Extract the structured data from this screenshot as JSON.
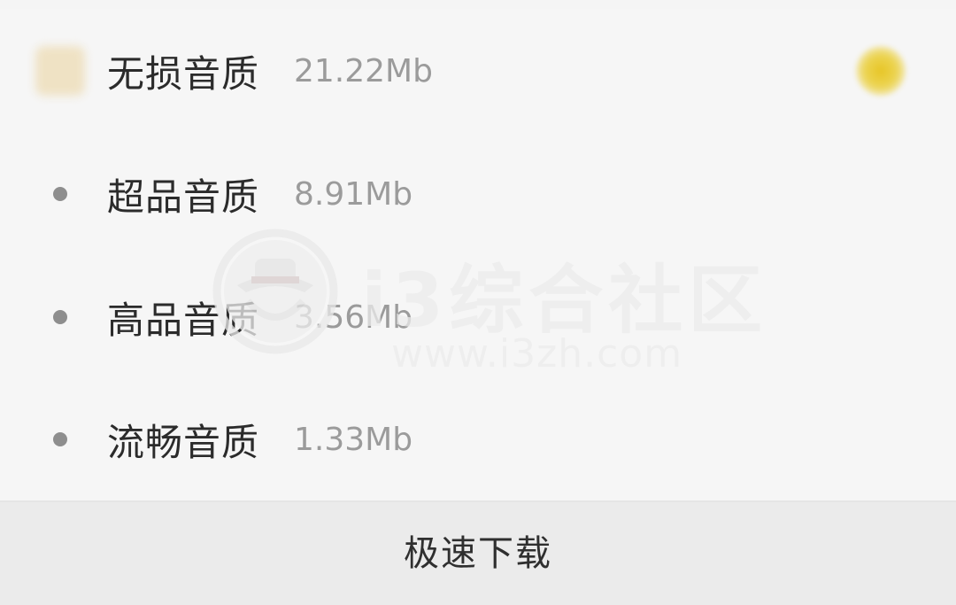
{
  "quality_options": [
    {
      "name": "无损音质",
      "size": "21.22Mb",
      "selected": true
    },
    {
      "name": "超品音质",
      "size": "8.91Mb",
      "selected": false
    },
    {
      "name": "高品音质",
      "size": "3.56Mb",
      "selected": false
    },
    {
      "name": "流畅音质",
      "size": "1.33Mb",
      "selected": false
    }
  ],
  "download_button": {
    "label": "极速下载"
  },
  "watermark": {
    "title": "i3综合社区",
    "url": "www.i3zh.com"
  },
  "colors": {
    "accent": "#e7c525",
    "text_primary": "#2b2b2b",
    "text_secondary": "#9b9b9b",
    "bullet": "#8e8e8e",
    "background": "#f6f6f6",
    "button_background": "#ebebeb"
  },
  "icons": {
    "first_option_icon": "quality-badge-icon",
    "selected_icon": "selected-radio-icon",
    "bullet_icon": "bullet-dot-icon"
  }
}
